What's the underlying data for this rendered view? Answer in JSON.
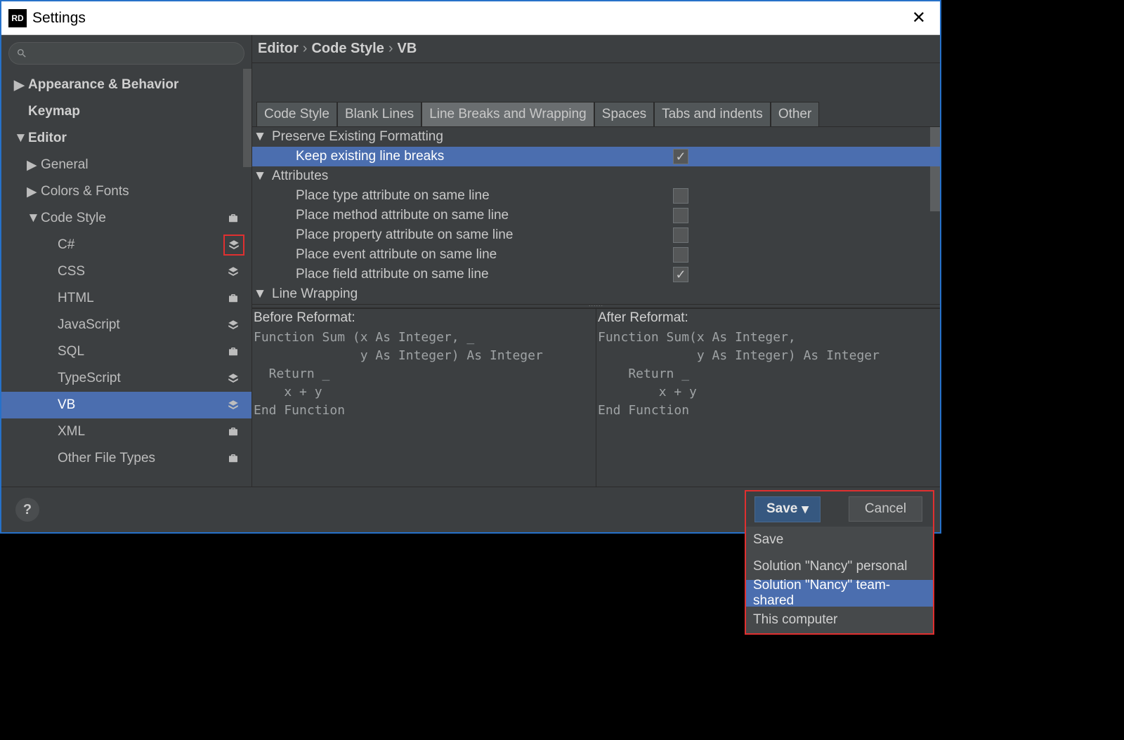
{
  "title": "Settings",
  "breadcrumb": [
    "Editor",
    "Code Style",
    "VB"
  ],
  "sidebar": {
    "items": [
      {
        "label": "Appearance & Behavior",
        "level": 0,
        "bold": true,
        "arrow": "right",
        "icon": null
      },
      {
        "label": "Keymap",
        "level": 0,
        "bold": true,
        "arrow": "none",
        "icon": null
      },
      {
        "label": "Editor",
        "level": 0,
        "bold": true,
        "arrow": "down",
        "icon": null
      },
      {
        "label": "General",
        "level": 1,
        "bold": false,
        "arrow": "right",
        "icon": null
      },
      {
        "label": "Colors & Fonts",
        "level": 1,
        "bold": false,
        "arrow": "right",
        "icon": null
      },
      {
        "label": "Code Style",
        "level": 1,
        "bold": false,
        "arrow": "down",
        "icon": "briefcase"
      },
      {
        "label": "C#",
        "level": 2,
        "bold": false,
        "arrow": "none",
        "icon": "layers",
        "iconHighlight": true
      },
      {
        "label": "CSS",
        "level": 2,
        "bold": false,
        "arrow": "none",
        "icon": "layers"
      },
      {
        "label": "HTML",
        "level": 2,
        "bold": false,
        "arrow": "none",
        "icon": "briefcase"
      },
      {
        "label": "JavaScript",
        "level": 2,
        "bold": false,
        "arrow": "none",
        "icon": "layers"
      },
      {
        "label": "SQL",
        "level": 2,
        "bold": false,
        "arrow": "none",
        "icon": "briefcase"
      },
      {
        "label": "TypeScript",
        "level": 2,
        "bold": false,
        "arrow": "none",
        "icon": "layers"
      },
      {
        "label": "VB",
        "level": 2,
        "bold": false,
        "arrow": "none",
        "icon": "layers",
        "selected": true
      },
      {
        "label": "XML",
        "level": 2,
        "bold": false,
        "arrow": "none",
        "icon": "briefcase"
      },
      {
        "label": "Other File Types",
        "level": 2,
        "bold": false,
        "arrow": "none",
        "icon": "briefcase"
      }
    ]
  },
  "tabs": [
    "Code Style",
    "Blank Lines",
    "Line Breaks and Wrapping",
    "Spaces",
    "Tabs and indents",
    "Other"
  ],
  "activeTabIndex": 2,
  "settings": {
    "groups": [
      {
        "label": "Preserve Existing Formatting",
        "items": [
          {
            "label": "Keep existing line breaks",
            "checked": true,
            "selected": true
          }
        ]
      },
      {
        "label": "Attributes",
        "items": [
          {
            "label": "Place type attribute on same line",
            "checked": false
          },
          {
            "label": "Place method attribute on same line",
            "checked": false
          },
          {
            "label": "Place property attribute on same line",
            "checked": false
          },
          {
            "label": "Place event attribute on same line",
            "checked": false
          },
          {
            "label": "Place field attribute on same line",
            "checked": true
          }
        ]
      },
      {
        "label": "Line Wrapping",
        "items": []
      }
    ]
  },
  "preview": {
    "beforeLabel": "Before Reformat:",
    "afterLabel": "After Reformat:",
    "before": "Function Sum (x As Integer, _\n              y As Integer) As Integer\n  Return _\n    x + y\nEnd Function",
    "after": "Function Sum(x As Integer,\n             y As Integer) As Integer\n    Return _\n        x + y\nEnd Function"
  },
  "footer": {
    "save": "Save",
    "cancel": "Cancel"
  },
  "dropdown": {
    "items": [
      {
        "label": "Save"
      },
      {
        "label": "Solution \"Nancy\" personal"
      },
      {
        "label": "Solution \"Nancy\" team-shared",
        "hover": true
      },
      {
        "label": "This computer"
      }
    ]
  }
}
